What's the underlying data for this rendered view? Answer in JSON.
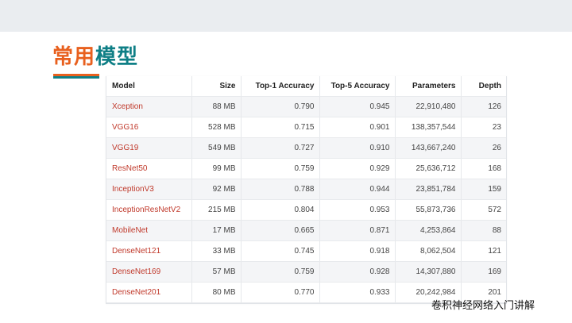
{
  "title": {
    "part1": "常用",
    "part2": "模型"
  },
  "table": {
    "headers": [
      "Model",
      "Size",
      "Top-1 Accuracy",
      "Top-5 Accuracy",
      "Parameters",
      "Depth"
    ],
    "rows": [
      [
        "Xception",
        "88 MB",
        "0.790",
        "0.945",
        "22,910,480",
        "126"
      ],
      [
        "VGG16",
        "528 MB",
        "0.715",
        "0.901",
        "138,357,544",
        "23"
      ],
      [
        "VGG19",
        "549 MB",
        "0.727",
        "0.910",
        "143,667,240",
        "26"
      ],
      [
        "ResNet50",
        "99 MB",
        "0.759",
        "0.929",
        "25,636,712",
        "168"
      ],
      [
        "InceptionV3",
        "92 MB",
        "0.788",
        "0.944",
        "23,851,784",
        "159"
      ],
      [
        "InceptionResNetV2",
        "215 MB",
        "0.804",
        "0.953",
        "55,873,736",
        "572"
      ],
      [
        "MobileNet",
        "17 MB",
        "0.665",
        "0.871",
        "4,253,864",
        "88"
      ],
      [
        "DenseNet121",
        "33 MB",
        "0.745",
        "0.918",
        "8,062,504",
        "121"
      ],
      [
        "DenseNet169",
        "57 MB",
        "0.759",
        "0.928",
        "14,307,880",
        "169"
      ],
      [
        "DenseNet201",
        "80 MB",
        "0.770",
        "0.933",
        "20,242,984",
        "201"
      ]
    ]
  },
  "footer": {
    "caption": "卷积神经网络入门讲解"
  },
  "colors": {
    "title_accent": "#e8601e",
    "title_teal": "#0f7f86",
    "model_link": "#c0392b"
  }
}
